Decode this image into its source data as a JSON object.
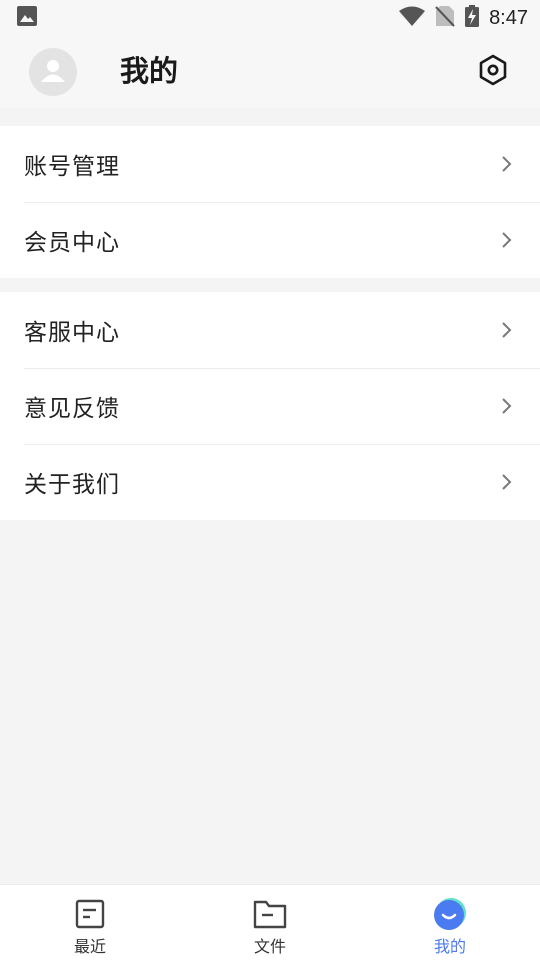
{
  "status_bar": {
    "time": "8:47",
    "icons": [
      "image-icon",
      "wifi-icon",
      "no-sim-icon",
      "battery-charging-icon"
    ]
  },
  "header": {
    "title": "我的",
    "avatar_icon": "person-icon",
    "settings_icon": "settings-hexagon-icon"
  },
  "menu_groups": [
    {
      "items": [
        {
          "label": "账号管理",
          "icon": "chevron-right-icon"
        },
        {
          "label": "会员中心",
          "icon": "chevron-right-icon"
        }
      ]
    },
    {
      "items": [
        {
          "label": "客服中心",
          "icon": "chevron-right-icon"
        },
        {
          "label": "意见反馈",
          "icon": "chevron-right-icon"
        },
        {
          "label": "关于我们",
          "icon": "chevron-right-icon"
        }
      ]
    }
  ],
  "bottom_nav": {
    "tabs": [
      {
        "label": "最近",
        "icon": "document-list-icon",
        "active": false
      },
      {
        "label": "文件",
        "icon": "folder-icon",
        "active": false
      },
      {
        "label": "我的",
        "icon": "profile-smile-icon",
        "active": true
      }
    ]
  },
  "colors": {
    "accent": "#4a7bf0",
    "accent_glow": "#5fe0c8",
    "background": "#f4f4f4",
    "card": "#ffffff",
    "text": "#222222"
  }
}
